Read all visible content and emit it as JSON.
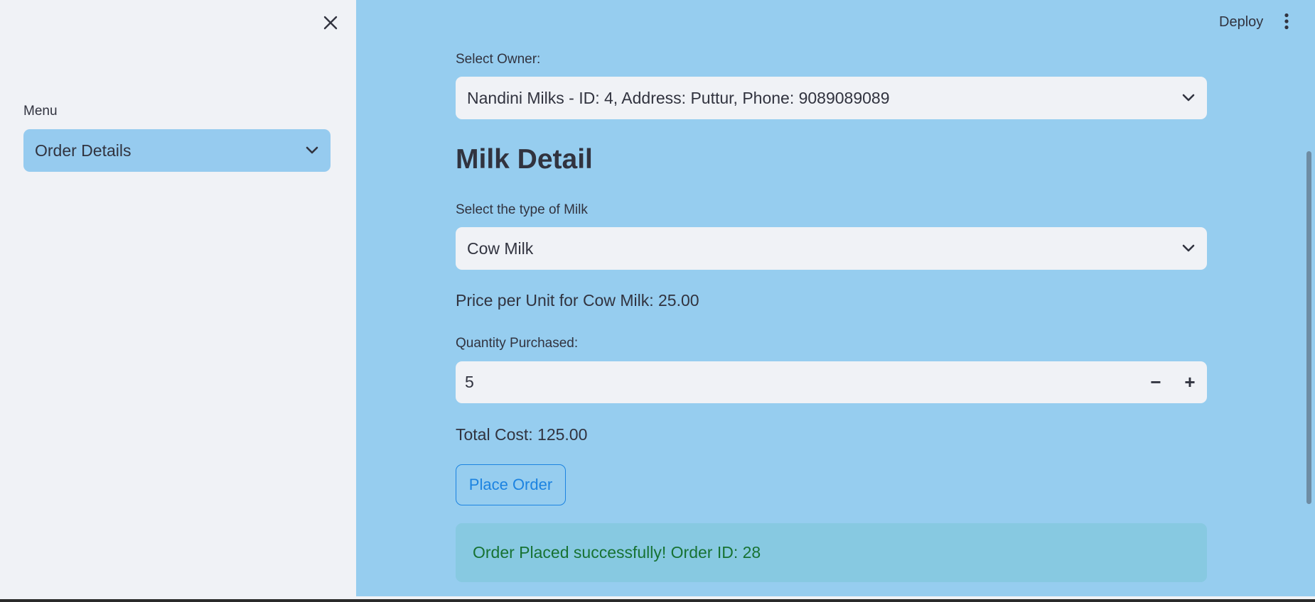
{
  "sidebar": {
    "menu_label": "Menu",
    "menu_selected": "Order Details"
  },
  "header": {
    "deploy_label": "Deploy"
  },
  "owner": {
    "label": "Select Owner:",
    "selected": "Nandini Milks - ID: 4, Address: Puttur, Phone: 9089089089"
  },
  "milk": {
    "heading": "Milk Detail",
    "type_label": "Select the type of Milk",
    "type_selected": "Cow Milk",
    "price_text": "Price per Unit for Cow Milk: 25.00"
  },
  "quantity": {
    "label": "Quantity Purchased:",
    "value": "5",
    "decrement": "−",
    "increment": "+"
  },
  "total_text": "Total Cost: 125.00",
  "place_order_label": "Place Order",
  "success_message": "Order Placed successfully! Order ID: 28",
  "colors": {
    "sidebar_bg": "#f0f2f6",
    "main_bg": "#96cdef",
    "primary": "#1c83e1",
    "success_text": "#177233"
  }
}
